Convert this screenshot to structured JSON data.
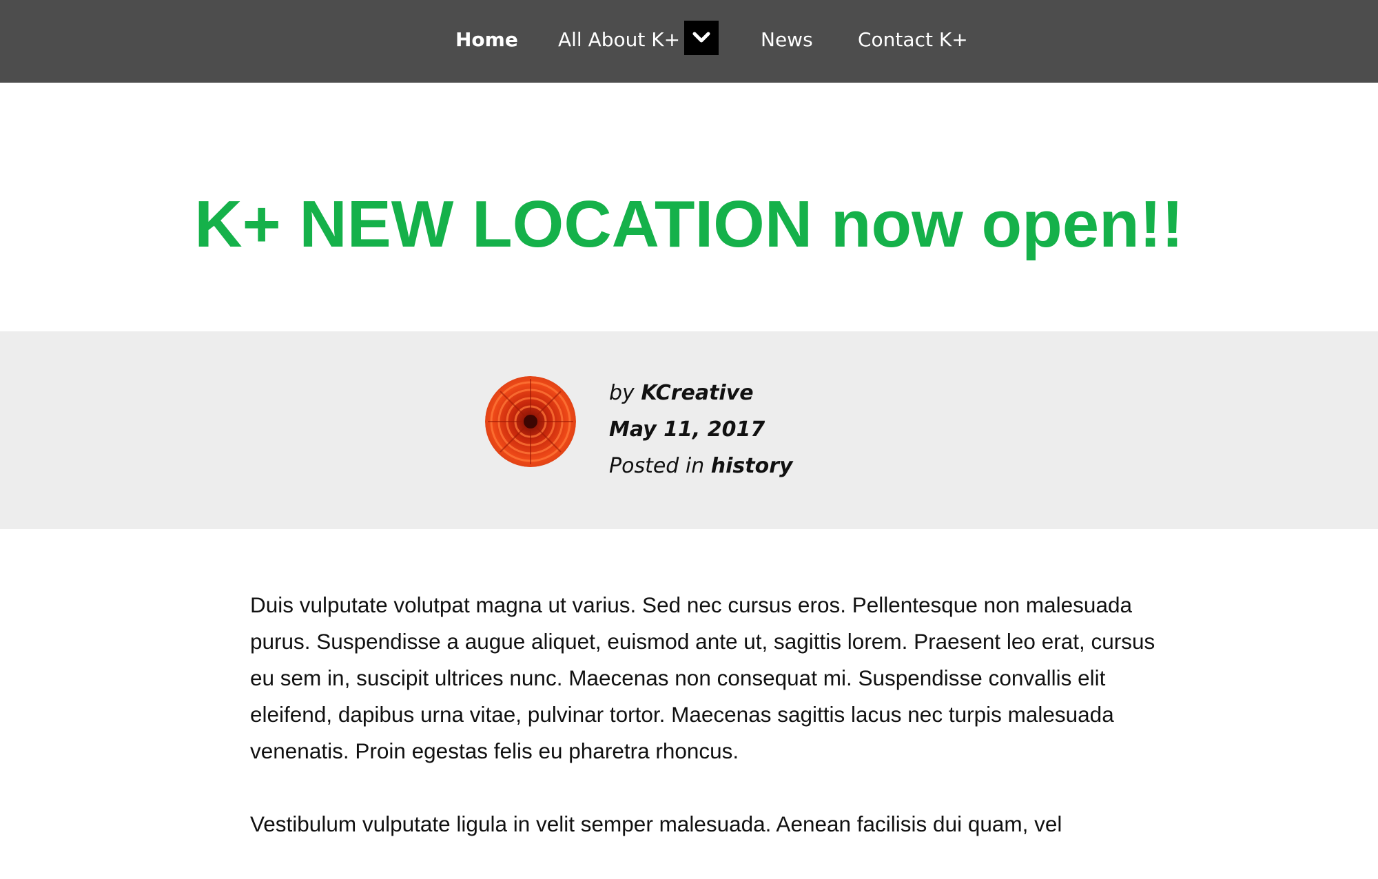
{
  "nav": {
    "items": [
      {
        "label": "Home"
      },
      {
        "label": "All About K+"
      },
      {
        "label": "News"
      },
      {
        "label": "Contact K+"
      }
    ],
    "dropdown_icon": "chevron-down-icon"
  },
  "post": {
    "title": "K+ NEW LOCATION now open!!",
    "title_color": "#15b14a",
    "meta": {
      "by_prefix": "by",
      "author": "KCreative",
      "date": "May 11, 2017",
      "posted_in_prefix": "Posted in",
      "category": "history"
    },
    "avatar_icon": "red-flower-avatar",
    "paragraphs": [
      "Duis vulputate volutpat magna ut varius. Sed nec cursus eros. Pellentesque non malesuada purus. Suspendisse a augue aliquet, euismod ante ut, sagittis lorem. Praesent leo erat, cursus eu sem in, suscipit ultrices nunc. Maecenas non consequat mi. Suspendisse convallis elit eleifend, dapibus urna vitae, pulvinar tortor. Maecenas sagittis lacus nec turpis malesuada venenatis. Proin egestas felis eu pharetra rhoncus.",
      "Vestibulum vulputate ligula in velit semper malesuada. Aenean facilisis dui quam, vel"
    ]
  },
  "colors": {
    "nav_bg": "#4d4d4d",
    "meta_bg": "#ededed",
    "accent": "#15b14a"
  }
}
